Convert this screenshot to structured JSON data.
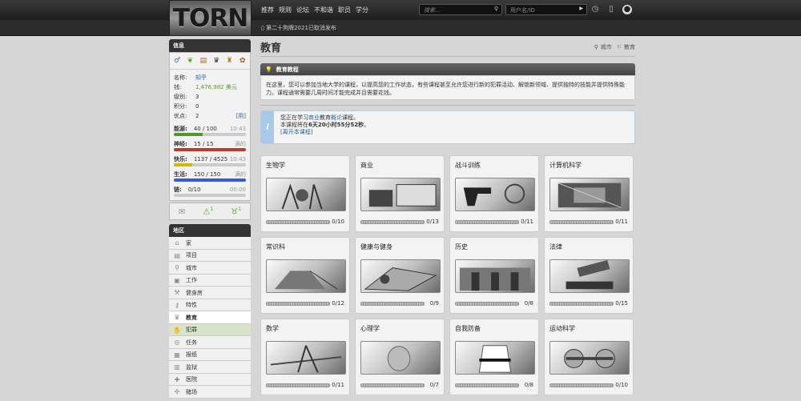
{
  "app": {
    "logo": "TORN"
  },
  "nav": [
    "推荐",
    "规则",
    "论坛",
    "不和谐",
    "职员",
    "学分"
  ],
  "search": {
    "placeholder": "搜索...",
    "user_placeholder": "用户名/ID"
  },
  "news": "第二十狗牌2021已取消发布",
  "sidebar": {
    "info_title": "信息",
    "name_label": "名称:",
    "name": "知乎",
    "money_label": "钱:",
    "money": "1,476,982 美元",
    "level_label": "级别:",
    "level": "3",
    "points_label": "积分:",
    "points": "0",
    "merits_label": "优点:",
    "merits": "2",
    "merits_action": "[用]",
    "bars": [
      {
        "label": "能源:",
        "value": "40 / 100",
        "time": "10:43",
        "fill": 0.4,
        "color": "#4e9a2a"
      },
      {
        "label": "神经:",
        "value": "15 / 15",
        "time": "满的",
        "fill": 1.0,
        "color": "#c0392b"
      },
      {
        "label": "快乐:",
        "value": "1137 / 4525",
        "time": "10:43",
        "fill": 0.25,
        "color": "#d4b800"
      },
      {
        "label": "生活:",
        "value": "150 / 150",
        "time": "满的",
        "fill": 1.0,
        "color": "#3a5bd9"
      },
      {
        "label": "链:",
        "value": "0/10",
        "time": "00:00",
        "fill": 0.0,
        "color": "#999999"
      }
    ],
    "quick": [
      {
        "icon": "mail-icon",
        "glyph": "✉",
        "count": ""
      },
      {
        "icon": "alert-icon",
        "glyph": "⚠",
        "count": "1"
      },
      {
        "icon": "event-icon",
        "glyph": "♉",
        "count": "1"
      }
    ],
    "areas_title": "地区",
    "areas": [
      {
        "label": "家",
        "glyph": "⌂"
      },
      {
        "label": "项目",
        "glyph": "▤"
      },
      {
        "label": "城市",
        "glyph": "⚲"
      },
      {
        "label": "工作",
        "glyph": "▣"
      },
      {
        "label": "健身房",
        "glyph": "⚒"
      },
      {
        "label": "特性",
        "glyph": "⚷"
      },
      {
        "label": "教育",
        "glyph": "♛"
      },
      {
        "label": "犯罪",
        "glyph": "✋"
      },
      {
        "label": "任务",
        "glyph": "◎"
      },
      {
        "label": "报纸",
        "glyph": "▦"
      },
      {
        "label": "监狱",
        "glyph": "▥"
      },
      {
        "label": "医院",
        "glyph": "✚"
      },
      {
        "label": "赌场",
        "glyph": "✣"
      }
    ]
  },
  "main": {
    "title": "教育",
    "crumb_city": "城市",
    "crumb_edu": "教育",
    "panel_title": "教育教程",
    "panel_text": "在这里，您可以参加当地大学的课程，以提高您的工作状态，有些课程甚至允许您进行新的犯罪活动、解锁新领域、提供独特的技能并提供特殊能力。课程通常需要几周时间才能完成并且需要花钱。",
    "notice": {
      "pre": "您正在学习",
      "subject": "商业",
      "mid": "教育",
      "course": "概论",
      "post": "课程。",
      "line2_pre": "本课程将在",
      "time": "6天20小时55分52秒",
      "line2_post": "。",
      "leave": "[离开本课程]"
    },
    "courses": [
      {
        "name": "生物学",
        "progress": "0/10"
      },
      {
        "name": "商业",
        "progress": "0/13"
      },
      {
        "name": "战斗训练",
        "progress": "0/11"
      },
      {
        "name": "计算机科学",
        "progress": "0/11"
      },
      {
        "name": "常识科",
        "progress": "0/12"
      },
      {
        "name": "健康与健身",
        "progress": "0/9"
      },
      {
        "name": "历史",
        "progress": "0/8"
      },
      {
        "name": "法律",
        "progress": "0/15"
      },
      {
        "name": "数学",
        "progress": "0/11"
      },
      {
        "name": "心理学",
        "progress": "0/7"
      },
      {
        "name": "自我防备",
        "progress": "0/8"
      },
      {
        "name": "运动科学",
        "progress": "0/10"
      }
    ]
  }
}
